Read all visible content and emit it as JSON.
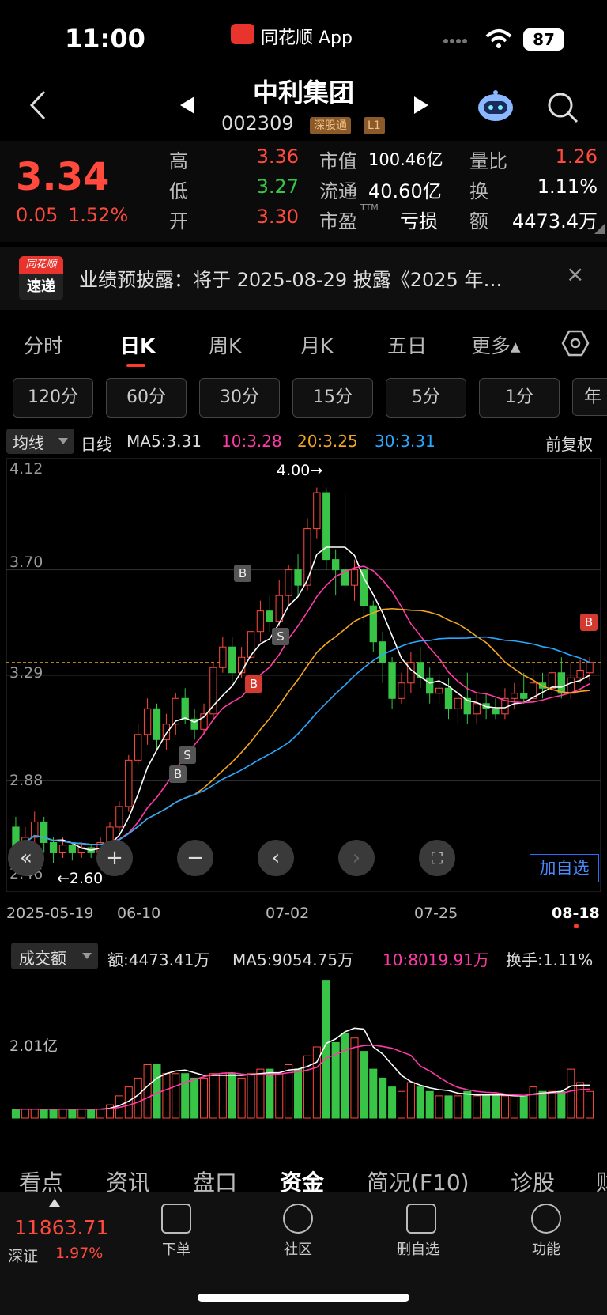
{
  "status_bar": {
    "time": "11:00",
    "app": "同花顺 App",
    "battery": "87"
  },
  "header": {
    "title": "中利集团",
    "code": "002309",
    "tag1": "深股通",
    "tag2": "L1"
  },
  "quote": {
    "price": "3.34",
    "change": "0.05",
    "change_pct": "1.52%",
    "high_label": "高",
    "high": "3.36",
    "low_label": "低",
    "low": "3.27",
    "open_label": "开",
    "open": "3.30",
    "mktcap_label": "市值",
    "mktcap": "100.46亿",
    "float_label": "流通",
    "float": "40.60亿",
    "pe_label": "市盈",
    "pe_sup": "TTM",
    "pe": "亏损",
    "volratio_label": "量比",
    "volratio": "1.26",
    "turnover_label": "换",
    "turnover": "1.11%",
    "amount_label": "额",
    "amount": "4473.4万"
  },
  "banner": {
    "logo_top": "同花顺",
    "logo_bottom": "速递",
    "text": "业绩预披露：将于 2025-08-29 披露《2025 年…",
    "close": "×"
  },
  "period_tabs": [
    "分时",
    "日K",
    "周K",
    "月K",
    "五日",
    "更多▴"
  ],
  "minute_tabs": [
    "120分",
    "60分",
    "30分",
    "15分",
    "5分",
    "1分",
    "年"
  ],
  "ma_bar": {
    "selector": "均线",
    "kind": "日线",
    "ma5": "MA5:3.31",
    "ma10": "10:3.28",
    "ma20": "20:3.25",
    "ma30": "30:3.31",
    "adjust": "前复权"
  },
  "chart_labels": {
    "y1": "4.12",
    "y2": "3.70",
    "y3": "3.29",
    "y4": "2.88",
    "y5": "2.46",
    "hi": "4.00→",
    "lo": "←2.60",
    "x1": "2025-05-19",
    "x2": "06-10",
    "x3": "07-02",
    "x4": "07-25",
    "x5": "08-18",
    "add": "加自选"
  },
  "vol_bar": {
    "selector": "成交额",
    "amount": "额:4473.41万",
    "ma5": "MA5:9054.75万",
    "ma10": "10:8019.91万",
    "turnover": "换手:1.11%",
    "ylabel": "2.01亿"
  },
  "colors": {
    "up": "#ff4a3d",
    "down": "#38c446",
    "ma5": "#ffffff",
    "ma10": "#ff3aa8",
    "ma20": "#f4a623",
    "ma30": "#2aa8ff"
  },
  "chart_data": {
    "type": "candlestick",
    "ylim": [
      2.46,
      4.12
    ],
    "series_count": 62,
    "candles": [
      [
        2.7,
        2.62,
        2.74,
        2.58
      ],
      [
        2.62,
        2.66,
        2.7,
        2.56
      ],
      [
        2.66,
        2.72,
        2.76,
        2.62
      ],
      [
        2.72,
        2.64,
        2.74,
        2.6
      ],
      [
        2.64,
        2.6,
        2.66,
        2.56
      ],
      [
        2.6,
        2.63,
        2.66,
        2.58
      ],
      [
        2.63,
        2.6,
        2.64,
        2.57
      ],
      [
        2.6,
        2.62,
        2.64,
        2.58
      ],
      [
        2.62,
        2.6,
        2.63,
        2.58
      ],
      [
        2.6,
        2.64,
        2.66,
        2.59
      ],
      [
        2.64,
        2.7,
        2.72,
        2.62
      ],
      [
        2.7,
        2.78,
        2.8,
        2.68
      ],
      [
        2.78,
        2.96,
        2.98,
        2.76
      ],
      [
        2.96,
        3.06,
        3.1,
        2.94
      ],
      [
        3.06,
        3.16,
        3.2,
        3.02
      ],
      [
        3.16,
        3.04,
        3.18,
        3.0
      ],
      [
        3.04,
        3.1,
        3.14,
        3.0
      ],
      [
        3.1,
        3.2,
        3.22,
        3.06
      ],
      [
        3.2,
        3.12,
        3.24,
        3.1
      ],
      [
        3.12,
        3.08,
        3.16,
        3.04
      ],
      [
        3.08,
        3.14,
        3.18,
        3.06
      ],
      [
        3.14,
        3.32,
        3.34,
        3.12
      ],
      [
        3.32,
        3.4,
        3.44,
        3.3
      ],
      [
        3.4,
        3.3,
        3.44,
        3.26
      ],
      [
        3.3,
        3.36,
        3.4,
        3.28
      ],
      [
        3.36,
        3.46,
        3.5,
        3.32
      ],
      [
        3.46,
        3.54,
        3.58,
        3.42
      ],
      [
        3.54,
        3.5,
        3.6,
        3.46
      ],
      [
        3.5,
        3.6,
        3.66,
        3.48
      ],
      [
        3.6,
        3.7,
        3.72,
        3.56
      ],
      [
        3.7,
        3.64,
        3.76,
        3.6
      ],
      [
        3.64,
        3.86,
        3.9,
        3.62
      ],
      [
        3.86,
        4.0,
        4.02,
        3.82
      ],
      [
        4.0,
        3.74,
        4.02,
        3.7
      ],
      [
        3.74,
        3.7,
        3.78,
        3.6
      ],
      [
        3.7,
        3.64,
        4.0,
        3.6
      ],
      [
        3.64,
        3.7,
        3.74,
        3.58
      ],
      [
        3.7,
        3.56,
        3.72,
        3.5
      ],
      [
        3.56,
        3.42,
        3.58,
        3.38
      ],
      [
        3.42,
        3.34,
        3.46,
        3.26
      ],
      [
        3.34,
        3.2,
        3.36,
        3.16
      ],
      [
        3.2,
        3.26,
        3.3,
        3.18
      ],
      [
        3.26,
        3.34,
        3.38,
        3.22
      ],
      [
        3.34,
        3.28,
        3.4,
        3.24
      ],
      [
        3.28,
        3.22,
        3.32,
        3.18
      ],
      [
        3.22,
        3.24,
        3.3,
        3.18
      ],
      [
        3.24,
        3.16,
        3.28,
        3.12
      ],
      [
        3.16,
        3.2,
        3.24,
        3.1
      ],
      [
        3.2,
        3.14,
        3.3,
        3.1
      ],
      [
        3.14,
        3.18,
        3.22,
        3.1
      ],
      [
        3.18,
        3.16,
        3.22,
        3.12
      ],
      [
        3.16,
        3.14,
        3.2,
        3.12
      ],
      [
        3.14,
        3.2,
        3.24,
        3.12
      ],
      [
        3.2,
        3.22,
        3.26,
        3.16
      ],
      [
        3.22,
        3.2,
        3.3,
        3.18
      ],
      [
        3.2,
        3.26,
        3.32,
        3.18
      ],
      [
        3.26,
        3.24,
        3.3,
        3.2
      ],
      [
        3.24,
        3.3,
        3.34,
        3.2
      ],
      [
        3.3,
        3.22,
        3.36,
        3.2
      ],
      [
        3.22,
        3.28,
        3.34,
        3.2
      ],
      [
        3.28,
        3.31,
        3.35,
        3.26
      ],
      [
        3.3,
        3.34,
        3.36,
        3.27
      ]
    ],
    "volume_ylim": [
      0,
      3.2
    ],
    "volume": [
      0.2,
      0.2,
      0.2,
      0.2,
      0.2,
      0.2,
      0.2,
      0.2,
      0.2,
      0.2,
      0.3,
      0.5,
      0.7,
      0.9,
      1.2,
      1.2,
      1.0,
      1.0,
      1.0,
      0.9,
      0.9,
      1.0,
      1.0,
      1.0,
      0.9,
      1.0,
      1.1,
      1.1,
      1.0,
      1.2,
      1.1,
      1.4,
      1.6,
      3.1,
      1.7,
      1.9,
      1.8,
      1.5,
      1.1,
      0.9,
      0.7,
      0.6,
      0.8,
      0.7,
      0.6,
      0.5,
      0.5,
      0.5,
      0.6,
      0.5,
      0.5,
      0.5,
      0.5,
      0.5,
      0.5,
      0.7,
      0.6,
      0.6,
      0.6,
      1.1,
      0.8,
      0.6
    ]
  }
}
